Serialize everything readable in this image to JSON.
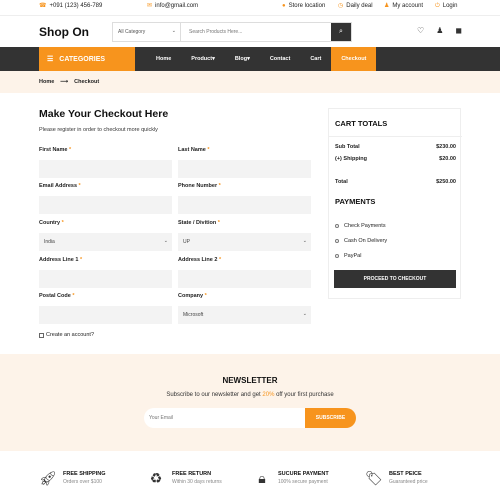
{
  "topbar": {
    "phone": "+091 (123) 456-789",
    "email": "info@gmail.com",
    "store_location": "Store location",
    "daily_deal": "Daily deal",
    "my_account": "My account",
    "login": "Login"
  },
  "header": {
    "logo": "Shop On",
    "category_select": "All Category",
    "search_placeholder": "Search Products Here..."
  },
  "nav": {
    "categories": "CATEGORIES",
    "items": [
      "Home",
      "Product",
      "Blog",
      "Contact",
      "Cart",
      "Checkout"
    ],
    "active": "Checkout"
  },
  "breadcrumb": {
    "home": "Home",
    "current": "Checkout"
  },
  "checkout": {
    "title": "Make Your Checkout Here",
    "subtitle": "Please register in order to checkout more quickly",
    "first_name": "First Name",
    "last_name": "Last Name",
    "email": "Email Address",
    "phone": "Phone Number",
    "country": "Country",
    "country_value": "India",
    "state": "State / Divition",
    "state_value": "UP",
    "address1": "Address Line 1",
    "address2": "Address Line 2",
    "postal": "Postal Code",
    "company": "Company",
    "company_value": "Microsoft",
    "required_mark": "*",
    "create_account": "Create an account?"
  },
  "cart": {
    "title": "CART TOTALS",
    "sub_total_label": "Sub Total",
    "sub_total": "$230.00",
    "shipping_label": "(+) Shipping",
    "shipping": "$20.00",
    "total_label": "Total",
    "total": "$250.00",
    "payments_title": "PAYMENTS",
    "payment_options": [
      "Check Payments",
      "Cash On Delivery",
      "PayPal"
    ],
    "proceed": "PROCEED TO CHECKOUT"
  },
  "newsletter": {
    "title": "NEWSLETTER",
    "text_before": "Subscribe to our newsletter and get ",
    "highlight": "20%",
    "text_after": " off your first purchase",
    "placeholder": "Your Email",
    "button": "SUBSCRIBE"
  },
  "features": [
    {
      "title": "FREE SHIPPING",
      "sub": "Orders over $100",
      "icon": "rocket-icon"
    },
    {
      "title": "FREE RETURN",
      "sub": "Within 30 days returns",
      "icon": "recycle-icon"
    },
    {
      "title": "SUCURE PAYMENT",
      "sub": "100% secure payment",
      "icon": "lock-icon"
    },
    {
      "title": "BEST PEICE",
      "sub": "Guaranteed price",
      "icon": "tag-icon"
    }
  ],
  "colors": {
    "accent": "#f7941d",
    "dark": "#333333",
    "cream": "#fdf3e9"
  }
}
